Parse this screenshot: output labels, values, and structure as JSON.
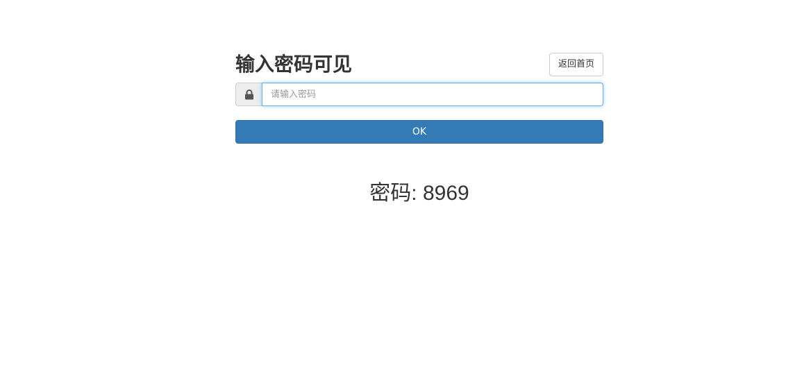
{
  "header": {
    "title": "输入密码可见",
    "home_button_label": "返回首页"
  },
  "form": {
    "lock_icon": "lock-icon",
    "password_placeholder": "请输入密码",
    "password_value": "",
    "submit_label": "OK"
  },
  "result": {
    "label": "密码:",
    "value": "8969"
  },
  "colors": {
    "primary": "#337ab7",
    "focus_border": "#66afe9"
  }
}
